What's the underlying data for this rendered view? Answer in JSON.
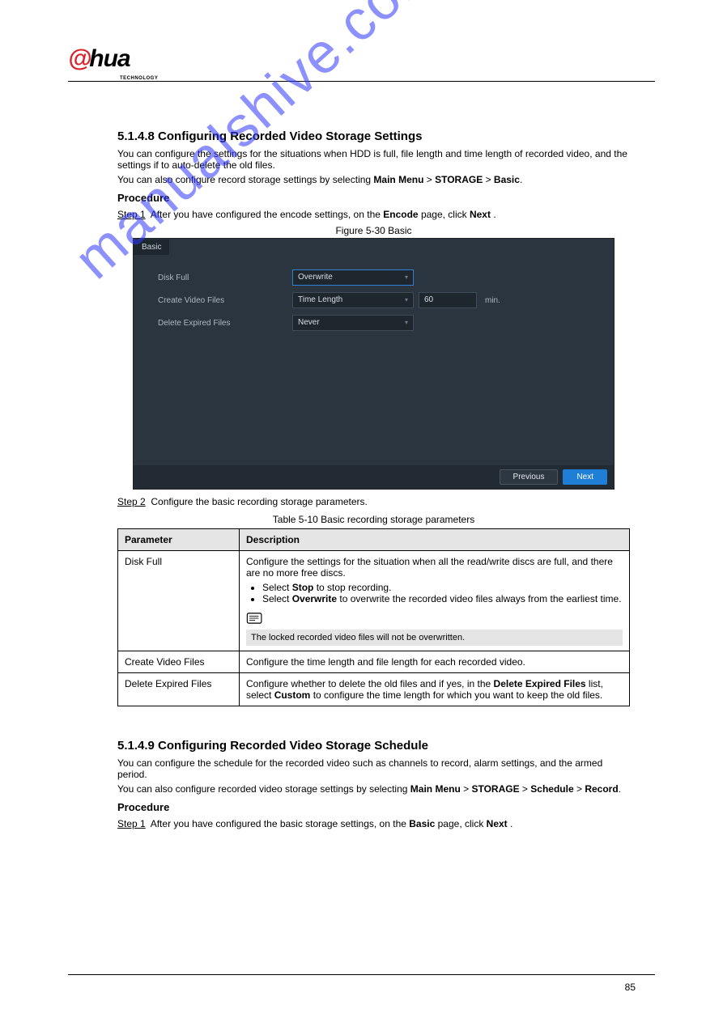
{
  "logo": {
    "prefix": "@",
    "text": "hua",
    "sublabel": "TECHNOLOGY"
  },
  "watermark": "manualshive.com",
  "section1": {
    "number": "5.1.4.8",
    "title": "Configuring Recorded Video Storage Settings",
    "intro_prefix": "You can configure the settings for the situations when HDD is full, file length and time length of recorded video, and the settings if to auto-delete the old files.",
    "intro_wizard": "You can also configure record storage settings by selecting ",
    "intro_path": [
      "Main Menu",
      "STORAGE",
      "Basic"
    ],
    "procedure_label": "Procedure",
    "step1": {
      "label": "Step 1",
      "text_pre": "After you have configured the encode settings, on the ",
      "encode": "Encode",
      "text_mid": " page, click ",
      "next": "Next",
      "text_post": "."
    },
    "fig_caption": "Figure 5-30 Basic",
    "step2": {
      "label": "Step 2",
      "text": "Configure the basic recording storage parameters."
    },
    "table_caption": "Table 5-10 Basic recording storage parameters",
    "headers": {
      "p": "Parameter",
      "d": "Description"
    },
    "rows": {
      "r0": {
        "p": "Disk Full",
        "d_intro": "Configure the settings for the situation when all the read/write discs are full, and there are no more free discs.",
        "b1_pre": "Select ",
        "b1_bold": "Stop",
        "b1_post": " to stop recording.",
        "b2_pre": "Select ",
        "b2_bold": "Overwrite",
        "b2_post": " to overwrite the recorded video files always from the earliest time.",
        "note": "The locked recorded video files will not be overwritten."
      },
      "r1": {
        "p": "Create Video Files",
        "d": "Configure the time length and file length for each recorded video."
      },
      "r2": {
        "p": "Delete Expired Files",
        "d_pre": "Configure whether to delete the old files and if yes, in the ",
        "d_bold": "Delete Expired Files",
        "d_mid": " list, select ",
        "d_bold2": "Custom",
        "d_post": " to configure the time length for which you want to keep the old files."
      }
    }
  },
  "screenshot": {
    "tab": "Basic",
    "rows": {
      "disk_full": {
        "label": "Disk Full",
        "value": "Overwrite"
      },
      "create_video": {
        "label": "Create Video Files",
        "value": "Time Length",
        "num": "60",
        "unit": "min."
      },
      "delete_expired": {
        "label": "Delete Expired Files",
        "value": "Never"
      }
    },
    "buttons": {
      "prev": "Previous",
      "next": "Next"
    }
  },
  "section2": {
    "number": "5.1.4.9",
    "title": "Configuring Recorded Video Storage Schedule",
    "intro": "You can configure the schedule for the recorded video such as channels to record, alarm settings, and the armed period.",
    "intro2_pre": "You can also configure recorded video storage settings by selecting ",
    "intro2_path": [
      "Main Menu",
      "STORAGE",
      "Schedule",
      "Record"
    ],
    "procedure_label": "Procedure",
    "step1": {
      "label": "Step 1",
      "text_pre": "After you have configured the basic storage settings, on the ",
      "basic": "Basic",
      "text_mid": " page, click ",
      "next": "Next",
      "text_post": "."
    }
  },
  "page_number": "85"
}
